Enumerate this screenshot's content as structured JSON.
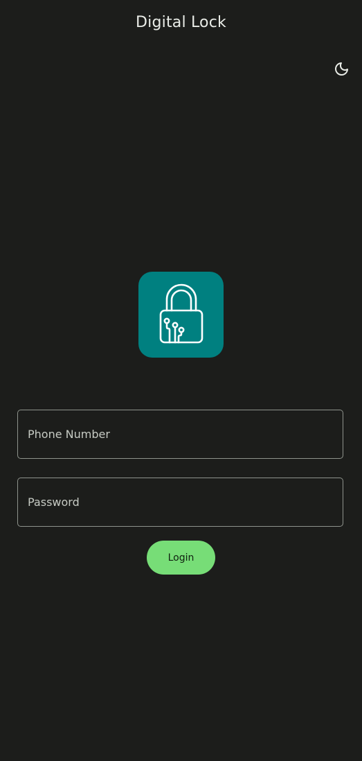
{
  "app_bar": {
    "title": "Digital Lock"
  },
  "theme_toggle": {
    "icon": "moon-icon"
  },
  "logo": {
    "icon": "padlock-circuit-icon",
    "background_color": "#008080"
  },
  "form": {
    "phone": {
      "placeholder": "Phone Number",
      "value": ""
    },
    "password": {
      "placeholder": "Password",
      "value": ""
    },
    "login_label": "Login"
  },
  "colors": {
    "background": "#1c1d1b",
    "accent": "#77dd77",
    "logo": "#008080"
  }
}
